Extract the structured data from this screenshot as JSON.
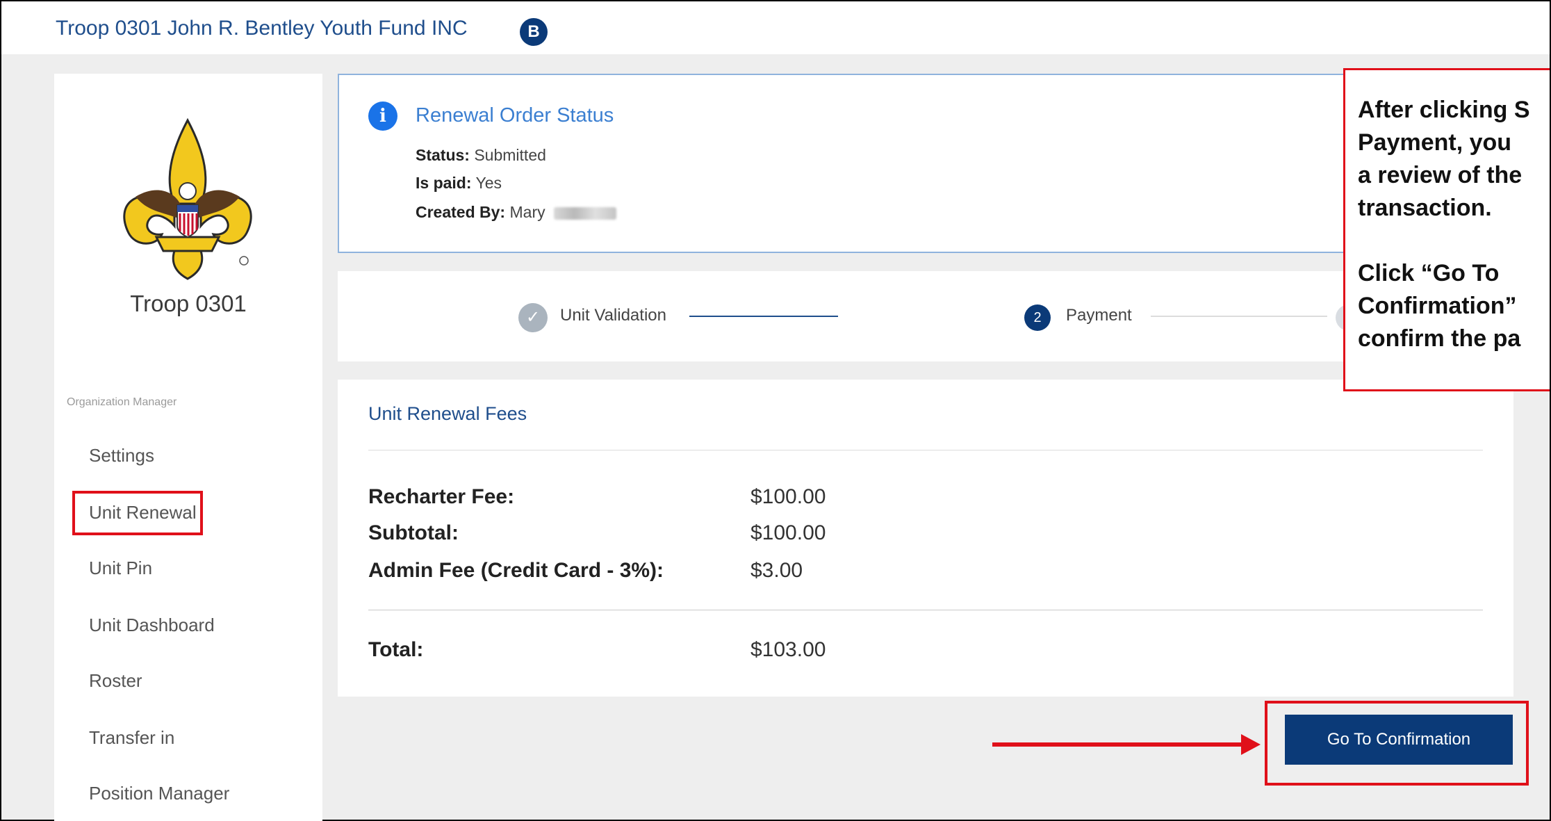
{
  "header": {
    "org_title": "Troop 0301 John R. Bentley Youth Fund INC",
    "badge": "B"
  },
  "sidebar": {
    "logo_icon": "bsa-fleur-de-lis-eagle-emblem",
    "unit_name": "Troop 0301",
    "section_label": "Organization Manager",
    "items": [
      {
        "label": "Settings"
      },
      {
        "label": "Unit Renewal"
      },
      {
        "label": "Unit Pin"
      },
      {
        "label": "Unit Dashboard"
      },
      {
        "label": "Roster"
      },
      {
        "label": "Transfer in"
      },
      {
        "label": "Position Manager"
      }
    ]
  },
  "status_card": {
    "icon": "info-icon",
    "title": "Renewal Order Status",
    "status_label": "Status:",
    "status_value": "Submitted",
    "paid_label": "Is paid:",
    "paid_value": "Yes",
    "created_label": "Created By:",
    "created_value": "Mary"
  },
  "stepper": {
    "step1_label": "Unit Validation",
    "step2_number": "2",
    "step2_label": "Payment"
  },
  "fees": {
    "title": "Unit Renewal Fees",
    "recharter_label": "Recharter Fee:",
    "recharter_value": "$100.00",
    "subtotal_label": "Subtotal:",
    "subtotal_value": "$100.00",
    "admin_label": "Admin Fee (Credit Card - 3%):",
    "admin_value": "$3.00",
    "total_label": "Total:",
    "total_value": "$103.00"
  },
  "actions": {
    "go_to_confirmation": "Go To Confirmation"
  },
  "callout": {
    "lines": [
      "After clicking S",
      "Payment, you",
      "a review of the",
      "transaction.",
      "",
      "Click “Go To",
      "Confirmation”",
      "confirm the pa"
    ]
  },
  "colors": {
    "accent_navy": "#0b3a78",
    "link_blue": "#3b7fd1",
    "annotation_red": "#e0101a"
  }
}
